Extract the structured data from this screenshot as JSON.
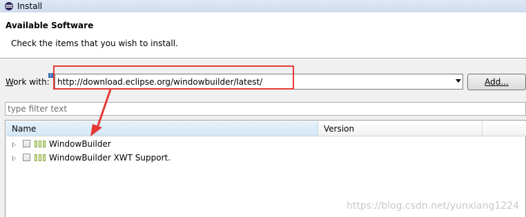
{
  "window": {
    "title": "Install"
  },
  "header": {
    "title": "Available Software",
    "description": "Check the items that you wish to install."
  },
  "work_with": {
    "label_accel": "W",
    "label_rest": "ork with:",
    "value": "http://download.eclipse.org/windowbuilder/latest/",
    "info_badge": "i"
  },
  "add_button": {
    "label": "Add..."
  },
  "filter": {
    "placeholder": "type filter text"
  },
  "table": {
    "columns": [
      "Name",
      "Version"
    ],
    "rows": [
      {
        "label": "WindowBuilder"
      },
      {
        "label": "WindowBuilder XWT Support."
      }
    ]
  },
  "watermark": "https://blog.csdn.net/yunxiang1224",
  "colors": {
    "highlight": "#e53935",
    "header_bg": "#ffffff",
    "selected_column": "#d3e6f6"
  }
}
